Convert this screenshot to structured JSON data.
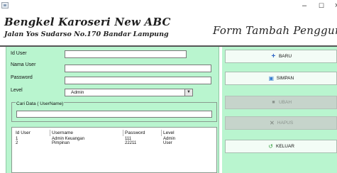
{
  "window": {
    "minimize_glyph": "–",
    "maximize_glyph": "☐",
    "close_glyph": "×"
  },
  "header": {
    "brand_title": "Bengkel Karoseri New ABC",
    "brand_address": "Jalan Yos Sudarso No.170 Bandar Lampung",
    "form_title": "Form Tambah Pengguna"
  },
  "form": {
    "id_user": {
      "label": "Id User",
      "value": ""
    },
    "nama_user": {
      "label": "Nama User",
      "value": ""
    },
    "password": {
      "label": "Password",
      "value": ""
    },
    "level": {
      "label": "Level",
      "selected": "Admin"
    },
    "search": {
      "legend": "Cari Data ( UserName)",
      "value": ""
    }
  },
  "table": {
    "columns": [
      "Id User",
      "Username",
      "Password",
      "Level"
    ],
    "rows": [
      [
        "1",
        "Admin Keuangan",
        "111",
        "Admin"
      ],
      [
        "2",
        "Pimpinan",
        "22211",
        "User"
      ]
    ]
  },
  "buttons": {
    "baru": {
      "label": "BARU",
      "icon": "plus-icon",
      "enabled": true
    },
    "simpan": {
      "label": "SIMPAN",
      "icon": "save-icon",
      "enabled": true
    },
    "ubah": {
      "label": "UBAH",
      "icon": "edit-icon",
      "enabled": false
    },
    "hapus": {
      "label": "HAPUS",
      "icon": "delete-icon",
      "enabled": false
    },
    "keluar": {
      "label": "KELUAR",
      "icon": "back-arrow-icon",
      "enabled": true
    }
  },
  "colors": {
    "panel_green": "#b9f5cf",
    "disabled_button": "#c6d4cb"
  }
}
